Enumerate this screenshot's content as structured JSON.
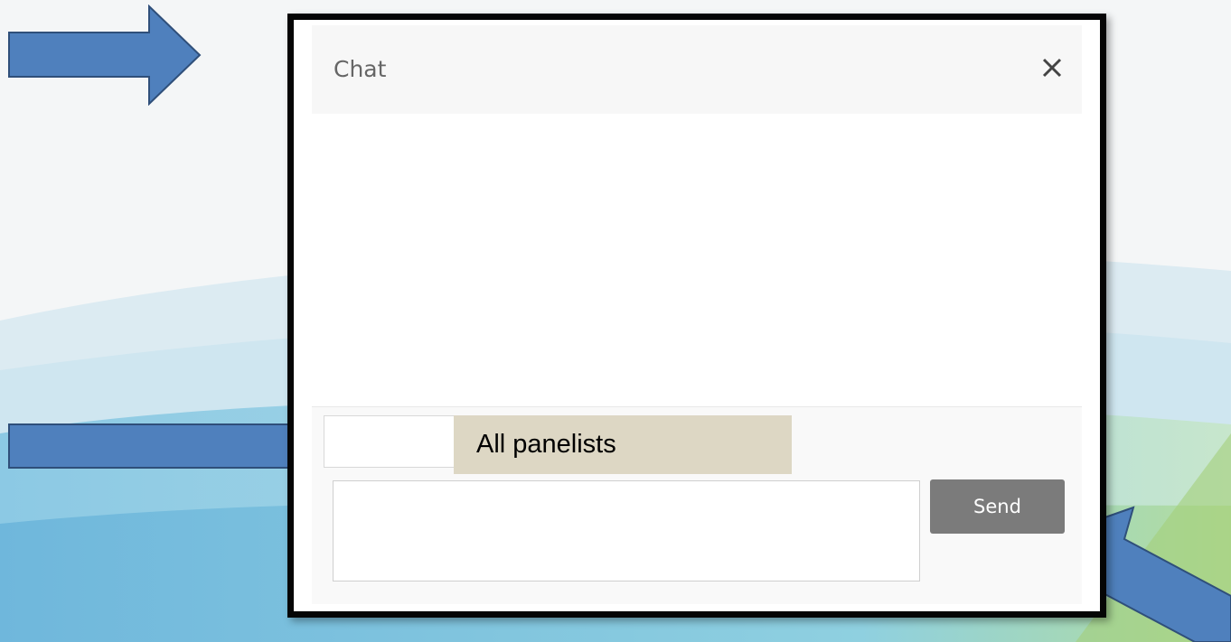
{
  "chat": {
    "title": "Chat",
    "recipient_label": "All panelists",
    "message_input": {
      "value": "",
      "placeholder": ""
    },
    "send_label": "Send"
  },
  "icons": {
    "close": "close-icon",
    "dropdown": "chevron-down-icon"
  },
  "colors": {
    "arrow_fill": "#4f80bd",
    "arrow_stroke": "#2f4f7a",
    "send_button": "#7b7b7b",
    "highlight": "#ddd7c4",
    "window_border": "#050505"
  }
}
